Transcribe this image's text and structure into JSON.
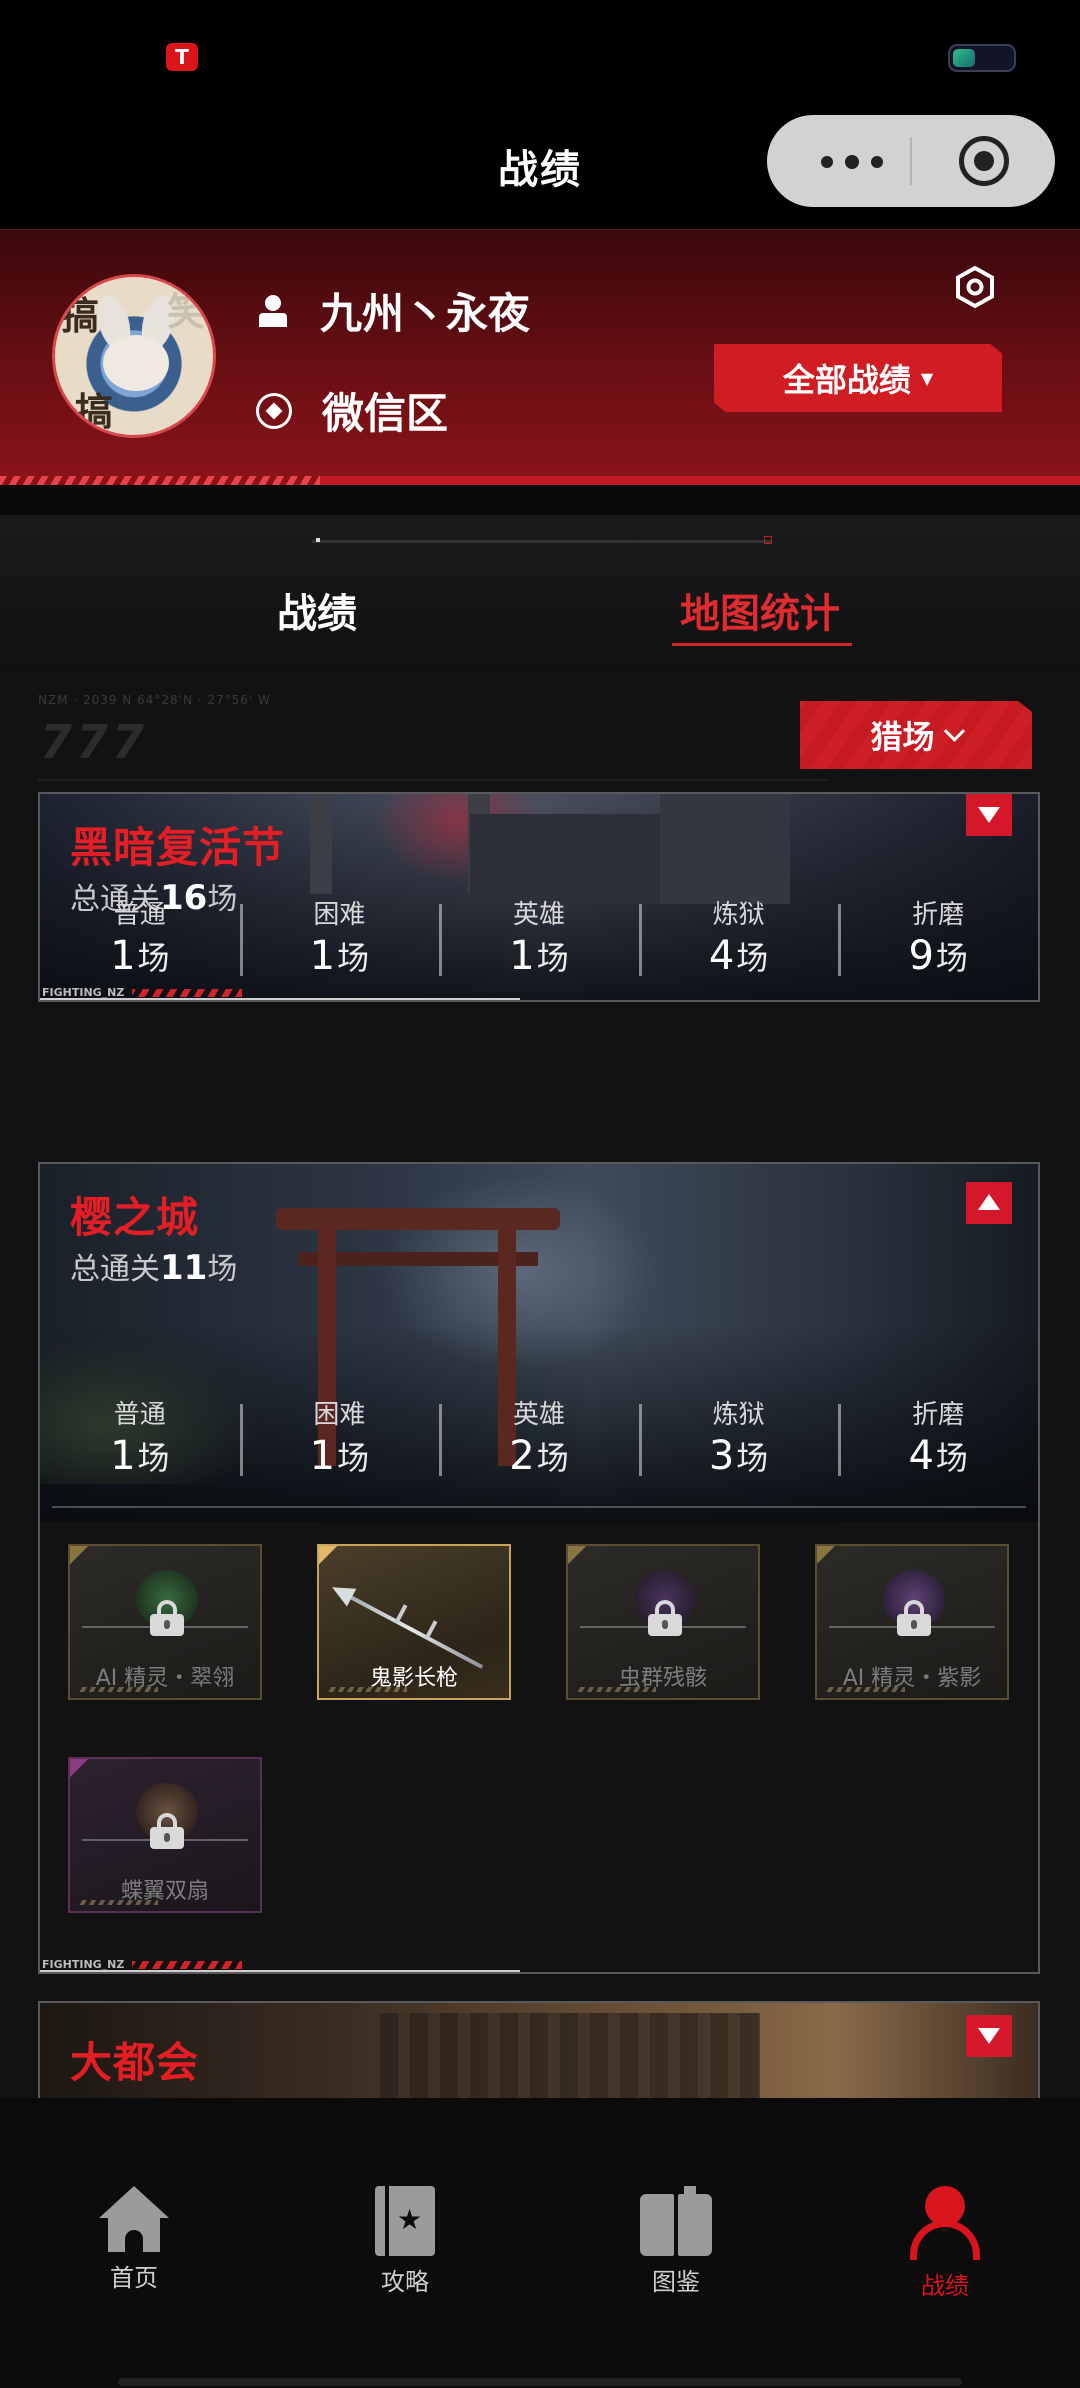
{
  "status_bar": {
    "app_badge": "T"
  },
  "nav": {
    "title": "战绩"
  },
  "profile": {
    "name": "九州丶永夜",
    "zone": "微信区",
    "avatar_text": [
      "搞",
      "搞",
      "笑"
    ],
    "all_records_button": "全部战绩",
    "all_records_caret": "▼"
  },
  "tabs": [
    {
      "label": "战绩",
      "active": false
    },
    {
      "label": "地图统计",
      "active": true
    }
  ],
  "decor": {
    "coords": "NZM · 2039 N 64°28'N · 27°56' W",
    "number": "777"
  },
  "filter": {
    "label": "猎场"
  },
  "maps": [
    {
      "name": "黑暗复活节",
      "total_prefix": "总通关",
      "total": "16",
      "total_unit": "场",
      "expanded": false,
      "stats": [
        {
          "label": "普通",
          "value": "1",
          "unit": "场"
        },
        {
          "label": "困难",
          "value": "1",
          "unit": "场"
        },
        {
          "label": "英雄",
          "value": "1",
          "unit": "场"
        },
        {
          "label": "炼狱",
          "value": "4",
          "unit": "场"
        },
        {
          "label": "折磨",
          "value": "9",
          "unit": "场"
        }
      ],
      "footer_label": "FIGHTING_NZ"
    },
    {
      "name": "樱之城",
      "total_prefix": "总通关",
      "total": "11",
      "total_unit": "场",
      "expanded": true,
      "stats": [
        {
          "label": "普通",
          "value": "1",
          "unit": "场"
        },
        {
          "label": "困难",
          "value": "1",
          "unit": "场"
        },
        {
          "label": "英雄",
          "value": "2",
          "unit": "场"
        },
        {
          "label": "炼狱",
          "value": "3",
          "unit": "场"
        },
        {
          "label": "折磨",
          "value": "4",
          "unit": "场"
        }
      ],
      "rewards": [
        {
          "name": "AI 精灵・翠翎",
          "locked": true
        },
        {
          "name": "鬼影长枪",
          "locked": false
        },
        {
          "name": "虫群残骸",
          "locked": true
        },
        {
          "name": "AI 精灵・紫影",
          "locked": true
        },
        {
          "name": "蝶翼双扇",
          "locked": true
        }
      ],
      "footer_label": "FIGHTING_NZ"
    },
    {
      "name": "大都会",
      "expanded": false
    }
  ],
  "tabbar": [
    {
      "label": "首页",
      "icon": "home-icon"
    },
    {
      "label": "攻略",
      "icon": "guide-icon"
    },
    {
      "label": "图鉴",
      "icon": "book-icon"
    },
    {
      "label": "战绩",
      "icon": "person-icon",
      "active": true
    }
  ],
  "colors": {
    "accent": "#d8141d",
    "tab_active": "#e02b2f",
    "header_red": "#8a141a"
  }
}
